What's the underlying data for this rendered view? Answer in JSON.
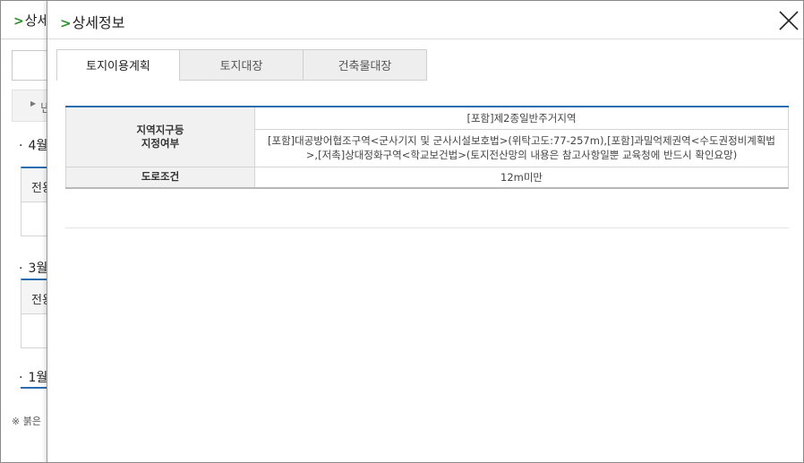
{
  "background": {
    "title": "상세",
    "grey_bar_text": "년",
    "months": [
      "4월",
      "3월",
      "1월"
    ],
    "table_header_text": "전용",
    "note": "※ 붉은"
  },
  "modal": {
    "title": "상세정보",
    "tabs": [
      {
        "label": "토지이용계획",
        "active": true
      },
      {
        "label": "토지대장",
        "active": false
      },
      {
        "label": "건축물대장",
        "active": false
      }
    ],
    "table": {
      "zone_header_line1": "지역지구등",
      "zone_header_line2": "지정여부",
      "zone_row1": "[포함]제2종일반주거지역",
      "zone_row2": "[포함]대공방어협조구역<군사기지 및 군사시설보호법>(위탁고도:77-257m),[포함]과밀억제권역<수도권정비계획법>,[저촉]상대정화구역<학교보건법>(토지전산망의 내용은 참고사항일뿐 교육청에 반드시 확인요망)",
      "road_header": "도로조건",
      "road_value": "12m미만"
    }
  },
  "colors": {
    "accent_green": "#2f8f2f",
    "table_top_border": "#2a6cb0"
  }
}
